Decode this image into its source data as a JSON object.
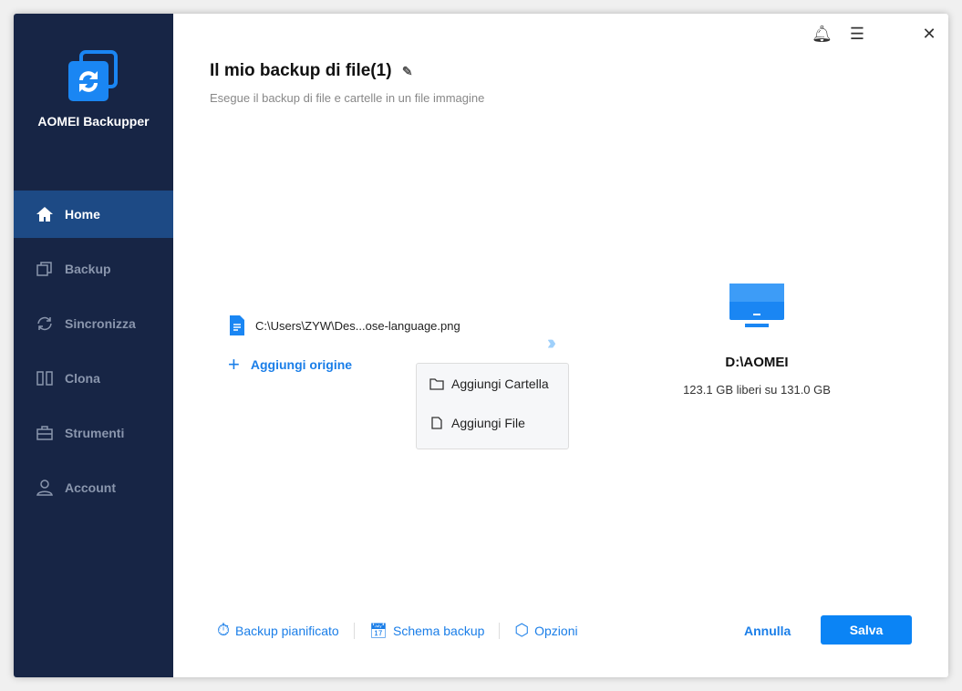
{
  "app": {
    "name": "AOMEI Backupper"
  },
  "sidebar": {
    "items": [
      {
        "label": "Home"
      },
      {
        "label": "Backup"
      },
      {
        "label": "Sincronizza"
      },
      {
        "label": "Clona"
      },
      {
        "label": "Strumenti"
      },
      {
        "label": "Account"
      }
    ]
  },
  "header": {
    "title": "Il mio backup di file(1)",
    "subtitle": "Esegue il backup di file e cartelle in un file immagine"
  },
  "source": {
    "path": "C:\\Users\\ZYW\\Des...ose-language.png",
    "add_label": "Aggiungi origine"
  },
  "menu": {
    "items": [
      {
        "label": "Aggiungi Cartella"
      },
      {
        "label": "Aggiungi File"
      }
    ]
  },
  "destination": {
    "name": "D:\\AOMEI",
    "space": "123.1 GB liberi su 131.0 GB"
  },
  "footer": {
    "schedule": "Backup pianificato",
    "scheme": "Schema backup",
    "options": "Opzioni",
    "cancel": "Annulla",
    "save": "Salva"
  }
}
